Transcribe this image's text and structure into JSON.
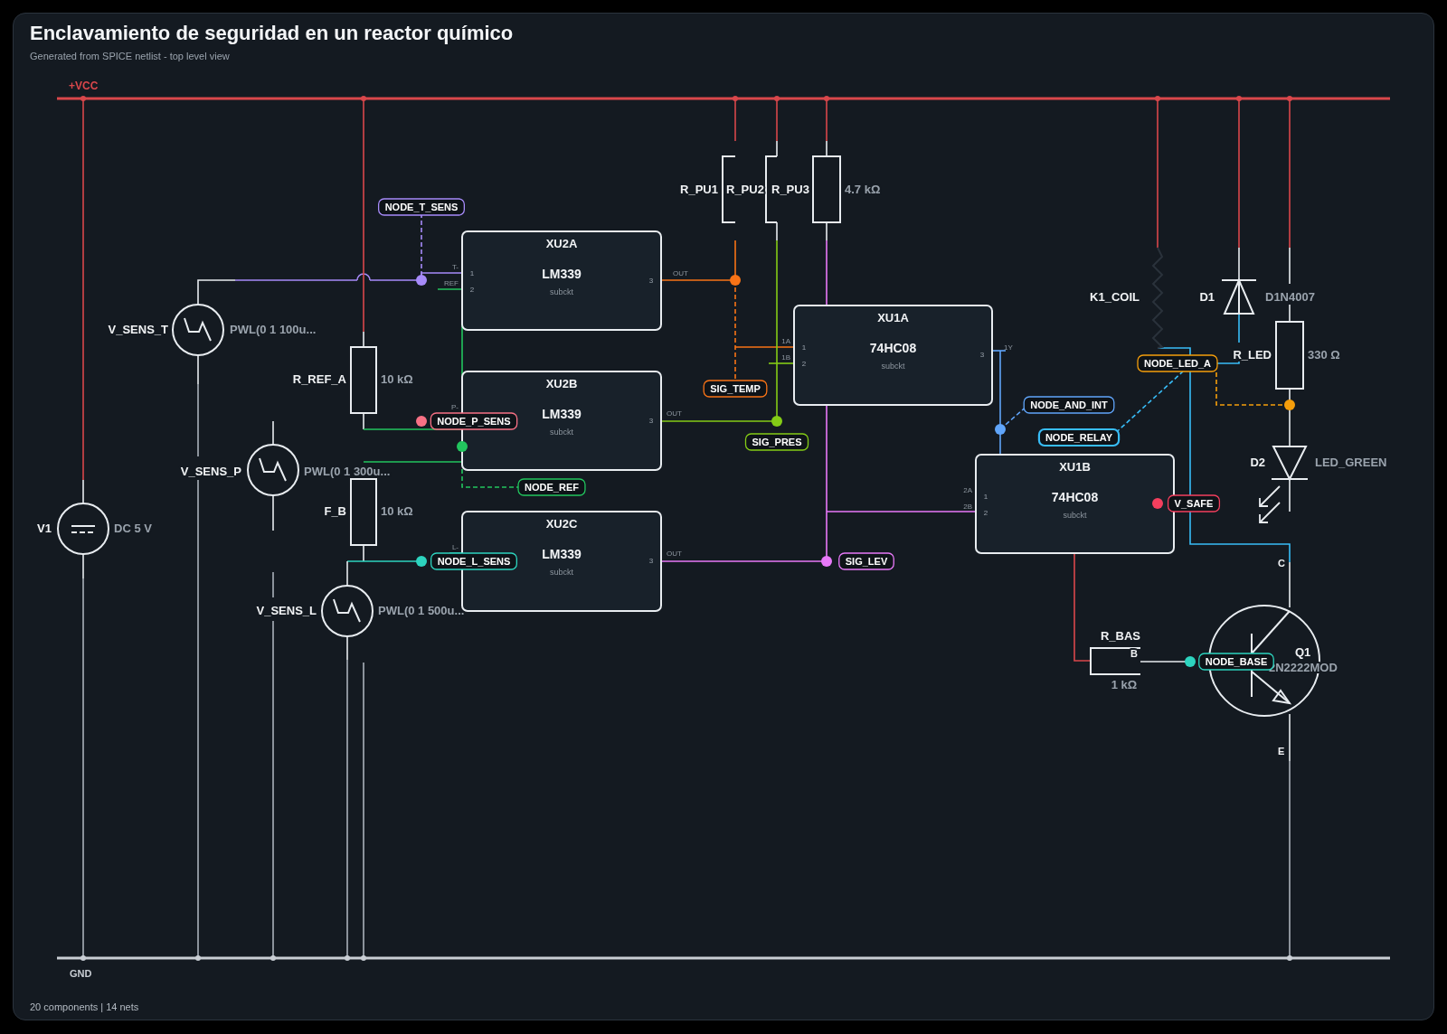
{
  "header": {
    "title": "Enclavamiento de seguridad en un reactor químico",
    "subtitle": "Generated from SPICE netlist - top level view"
  },
  "rails": [
    {
      "kind": "supply",
      "label": "+VCC"
    },
    {
      "kind": "ground",
      "label": "GND"
    }
  ],
  "components": [
    {
      "kind": "dc_source",
      "designator": "V1",
      "value": "DC 5 V"
    },
    {
      "kind": "pwl_source",
      "designator": "V_SENS_T",
      "value": "PWL(0 1 100u..."
    },
    {
      "kind": "resistor",
      "designator": "R_REF_A",
      "value": "10 kΩ"
    },
    {
      "kind": "pwl_source",
      "designator": "V_SENS_P",
      "value": "PWL(0 1 300u..."
    },
    {
      "kind": "resistor",
      "designator": "F_B",
      "value": "10 kΩ"
    },
    {
      "kind": "pwl_source",
      "designator": "V_SENS_L",
      "value": "PWL(0 1 500u..."
    },
    {
      "kind": "ic",
      "designator": "XU2A",
      "part": "LM339",
      "note": "subckt",
      "left_pins": [
        {
          "number": "1",
          "name": "T-"
        },
        {
          "number": "2",
          "name": "REF"
        }
      ],
      "right_pins": [
        {
          "number": "3",
          "name": "OUT"
        }
      ]
    },
    {
      "kind": "ic",
      "designator": "XU2B",
      "part": "LM339",
      "note": "subckt",
      "left_pins": [
        {
          "name": "P-"
        }
      ],
      "right_pins": [
        {
          "number": "3",
          "name": "OUT"
        }
      ]
    },
    {
      "kind": "ic",
      "designator": "XU2C",
      "part": "LM339",
      "note": "subckt",
      "left_pins": [
        {
          "name": "L-"
        }
      ],
      "right_pins": [
        {
          "number": "3",
          "name": "OUT"
        }
      ]
    },
    {
      "kind": "resistor",
      "designator": "R_PU1"
    },
    {
      "kind": "resistor",
      "designator": "R_PU2"
    },
    {
      "kind": "resistor",
      "designator": "R_PU3",
      "value": "4.7 kΩ"
    },
    {
      "kind": "ic",
      "designator": "XU1A",
      "part": "74HC08",
      "note": "subckt",
      "left_pins": [
        {
          "number": "1",
          "name": "1A"
        },
        {
          "number": "2",
          "name": "1B"
        }
      ],
      "right_pins": [
        {
          "number": "3",
          "name": "1Y"
        }
      ]
    },
    {
      "kind": "ic",
      "designator": "XU1B",
      "part": "74HC08",
      "note": "subckt",
      "left_pins": [
        {
          "number": "1",
          "name": "2A"
        },
        {
          "number": "2",
          "name": "2B"
        }
      ]
    },
    {
      "kind": "relay_coil",
      "designator": "K1_COIL"
    },
    {
      "kind": "diode",
      "designator": "D1",
      "value": "D1N4007"
    },
    {
      "kind": "resistor",
      "designator": "R_LED",
      "value": "330 Ω"
    },
    {
      "kind": "led",
      "designator": "D2",
      "value": "LED_GREEN"
    },
    {
      "kind": "npn_transistor",
      "designator": "Q1",
      "value": "2N2222MOD",
      "pins": [
        {
          "name": "C"
        },
        {
          "name": "B"
        },
        {
          "name": "E"
        }
      ]
    },
    {
      "kind": "resistor",
      "designator": "R_BAS",
      "value": "1 kΩ"
    }
  ],
  "net_labels": [
    {
      "text": "NODE_T_SENS",
      "color": "#a78bfa"
    },
    {
      "text": "NODE_P_SENS",
      "color": "#f87185"
    },
    {
      "text": "NODE_REF",
      "color": "#22c55e"
    },
    {
      "text": "NODE_L_SENS",
      "color": "#2dd4bf"
    },
    {
      "text": "SIG_TEMP",
      "color": "#f97316"
    },
    {
      "text": "SIG_PRES",
      "color": "#84cc16"
    },
    {
      "text": "SIG_LEV",
      "color": "#e879f9"
    },
    {
      "text": "NODE_AND_INT",
      "color": "#60a5fa"
    },
    {
      "text": "NODE_RELAY",
      "color": "#38bdf8"
    },
    {
      "text": "NODE_LED_A",
      "color": "#f59e0b"
    },
    {
      "text": "V_SAFE",
      "color": "#f43f5e"
    },
    {
      "text": "NODE_BASE",
      "color": "#2dd4bf"
    }
  ],
  "footer": "20 components | 14 nets"
}
